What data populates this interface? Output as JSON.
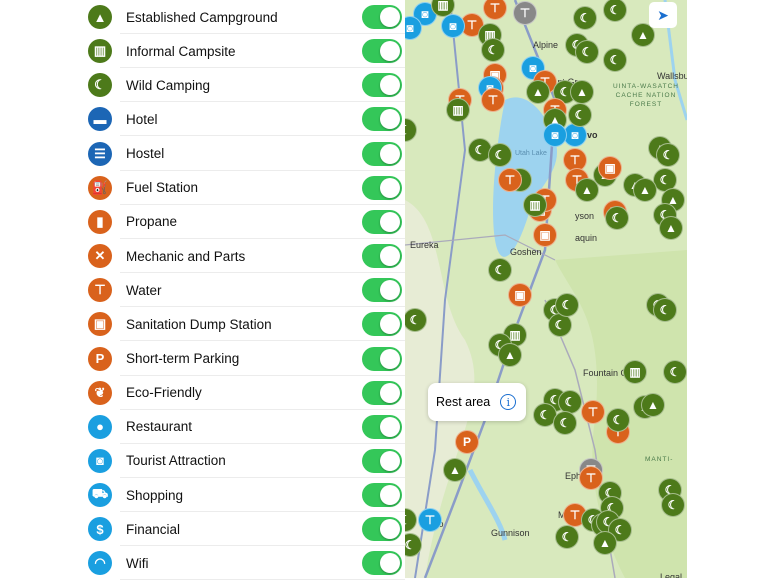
{
  "filters": [
    {
      "label": "Established Campground",
      "icon": "tent-icon",
      "color": "#4d7a1a",
      "glyph": "▲",
      "on": true
    },
    {
      "label": "Informal Campsite",
      "icon": "building-icon",
      "color": "#4d7a1a",
      "glyph": "▥",
      "on": true
    },
    {
      "label": "Wild Camping",
      "icon": "moon-icon",
      "color": "#4d7a1a",
      "glyph": "☾",
      "on": true
    },
    {
      "label": "Hotel",
      "icon": "bed-icon",
      "color": "#1c66b5",
      "glyph": "▬",
      "on": true
    },
    {
      "label": "Hostel",
      "icon": "bunk-bed-icon",
      "color": "#1c66b5",
      "glyph": "☰",
      "on": true
    },
    {
      "label": "Fuel Station",
      "icon": "fuel-icon",
      "color": "#d9621c",
      "glyph": "⛽",
      "on": true
    },
    {
      "label": "Propane",
      "icon": "propane-tank-icon",
      "color": "#d9621c",
      "glyph": "▮",
      "on": true
    },
    {
      "label": "Mechanic and Parts",
      "icon": "tools-icon",
      "color": "#d9621c",
      "glyph": "✕",
      "on": true
    },
    {
      "label": "Water",
      "icon": "tap-icon",
      "color": "#d9621c",
      "glyph": "⊤",
      "on": true
    },
    {
      "label": "Sanitation Dump Station",
      "icon": "rv-icon",
      "color": "#d9621c",
      "glyph": "▣",
      "on": true
    },
    {
      "label": "Short-term Parking",
      "icon": "parking-icon",
      "color": "#d9621c",
      "glyph": "P",
      "on": true
    },
    {
      "label": "Eco-Friendly",
      "icon": "leaf-icon",
      "color": "#d9621c",
      "glyph": "❦",
      "on": true
    },
    {
      "label": "Restaurant",
      "icon": "plate-icon",
      "color": "#1a9fe0",
      "glyph": "●",
      "on": true
    },
    {
      "label": "Tourist Attraction",
      "icon": "camera-icon",
      "color": "#1a9fe0",
      "glyph": "◙",
      "on": true
    },
    {
      "label": "Shopping",
      "icon": "cart-icon",
      "color": "#1a9fe0",
      "glyph": "⛟",
      "on": true
    },
    {
      "label": "Financial",
      "icon": "dollar-icon",
      "color": "#1a9fe0",
      "glyph": "$",
      "on": true
    },
    {
      "label": "Wifi",
      "icon": "wifi-icon",
      "color": "#1a9fe0",
      "glyph": "◠",
      "on": true
    }
  ],
  "map": {
    "callout": {
      "title": "Rest area",
      "info": "i"
    },
    "towns": [
      "Alpine",
      "easant Gr",
      "vo",
      "Wallsburg",
      "yson",
      "aquin",
      "Eureka",
      "Goshen",
      "Fountain Gre",
      "Mo",
      "Ephra",
      "Ma",
      "cipio",
      "Gunnison",
      "jan",
      "Legal",
      "Utah Lake"
    ],
    "forests": [
      "UINTA-WASATCH\nCACHE NATION\nFOREST",
      "MANTI-"
    ],
    "location_button": "➤"
  }
}
